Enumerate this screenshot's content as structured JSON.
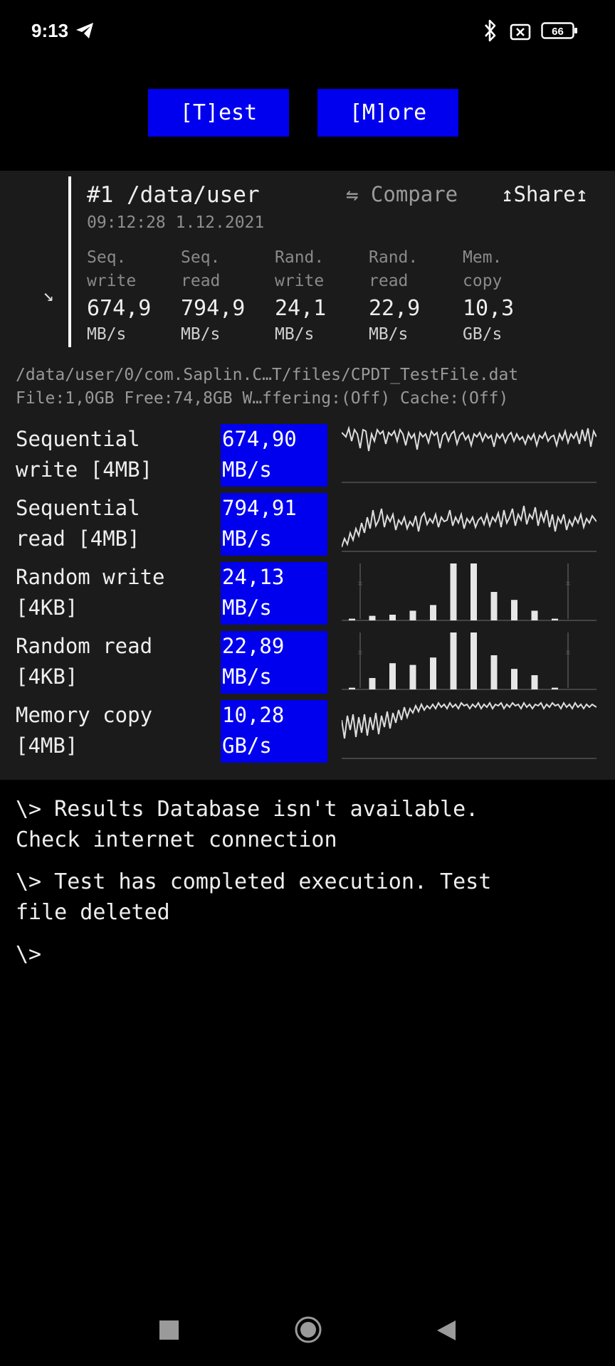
{
  "status_bar": {
    "time": "9:13",
    "battery": "66",
    "icons": [
      "telegram-icon",
      "bluetooth-icon",
      "sim-off-icon",
      "battery-icon"
    ]
  },
  "buttons": {
    "test": "[T]est",
    "more": "[M]ore"
  },
  "result": {
    "title": "#1 /data/user",
    "timestamp": "09:12:28 1.12.2021",
    "compare": "⇋ Compare",
    "share": "↥Share↥",
    "arrow": "↘",
    "summary": [
      {
        "l1": "Seq.",
        "l2": "write",
        "value": "674,9",
        "unit": "MB/s"
      },
      {
        "l1": "Seq.",
        "l2": "read",
        "value": "794,9",
        "unit": "MB/s"
      },
      {
        "l1": "Rand.",
        "l2": "write",
        "value": "24,1",
        "unit": "MB/s"
      },
      {
        "l1": "Rand.",
        "l2": "read",
        "value": "22,9",
        "unit": "MB/s"
      },
      {
        "l1": "Mem.",
        "l2": "copy",
        "value": "10,3",
        "unit": "GB/s"
      }
    ]
  },
  "file": {
    "path": "/data/user/0/com.Saplin.C…T/files/CPDT_TestFile.dat",
    "info": "File:1,0GB Free:74,8GB W…ffering:(Off) Cache:(Off)"
  },
  "tests": [
    {
      "l1": "Sequential",
      "l2": "write [4MB]",
      "value": "674,90",
      "unit": "MB/s"
    },
    {
      "l1": "Sequential",
      "l2": "read [4MB]",
      "value": "794,91",
      "unit": "MB/s"
    },
    {
      "l1": "Random write",
      "l2": "[4KB]",
      "value": "24,13",
      "unit": "MB/s",
      "bars": [
        0.03,
        0.08,
        0.1,
        0.17,
        0.27,
        1.0,
        1.0,
        0.5,
        0.36,
        0.17,
        0.03
      ]
    },
    {
      "l1": "Random read",
      "l2": "[4KB]",
      "value": "22,89",
      "unit": "MB/s",
      "bars": [
        0.03,
        0.2,
        0.46,
        0.43,
        0.56,
        1.0,
        1.0,
        0.6,
        0.36,
        0.25,
        0.03
      ]
    },
    {
      "l1": "Memory copy",
      "l2": "[4MB]",
      "value": "10,28",
      "unit": "GB/s"
    }
  ],
  "console": {
    "line1a": "\\> Results Database isn't available.",
    "line1b": "Check internet connection",
    "line2a": "\\> Test has completed execution. Test",
    "line2b": "file deleted",
    "prompt": "\\>"
  },
  "colors": {
    "accent": "#0000ee",
    "panel": "#1b1b1b",
    "muted": "#8a8a8a"
  }
}
